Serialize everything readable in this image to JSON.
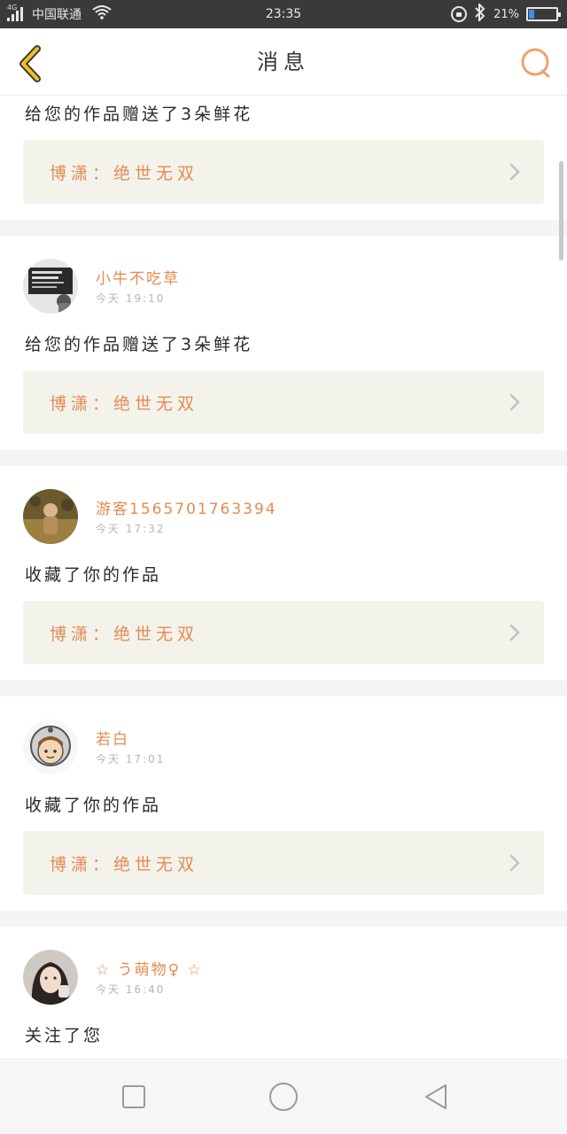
{
  "status_bar": {
    "network": "4G",
    "carrier": "中国联通",
    "time": "23:35",
    "battery_text": "21%",
    "battery_level": 0.21
  },
  "header": {
    "title": "消息"
  },
  "work_link_label": "博潇：绝世无双",
  "messages": [
    {
      "message": "给您的作品赠送了3朵鲜花",
      "work": "博潇：绝世无双"
    },
    {
      "name": "小牛不吃草",
      "time": "今天 19:10",
      "message": "给您的作品赠送了3朵鲜花",
      "work": "博潇：绝世无双"
    },
    {
      "name": "游客1565701763394",
      "time": "今天 17:32",
      "message": "收藏了你的作品",
      "work": "博潇：绝世无双"
    },
    {
      "name": "若白",
      "time": "今天 17:01",
      "message": "收藏了你的作品",
      "work": "博潇：绝世无双"
    },
    {
      "name": "☆ う萌物♀ ☆",
      "time": "今天 16:40",
      "message": "关注了您"
    }
  ],
  "colors": {
    "accent": "#e48b52",
    "back_arrow": "#f0c419",
    "card_bg": "#f3f3ec"
  },
  "icons": {
    "back": "chevron-left-icon",
    "search": "search-icon",
    "nav_recent": "square-icon",
    "nav_home": "circle-icon",
    "nav_back": "triangle-left-icon"
  }
}
